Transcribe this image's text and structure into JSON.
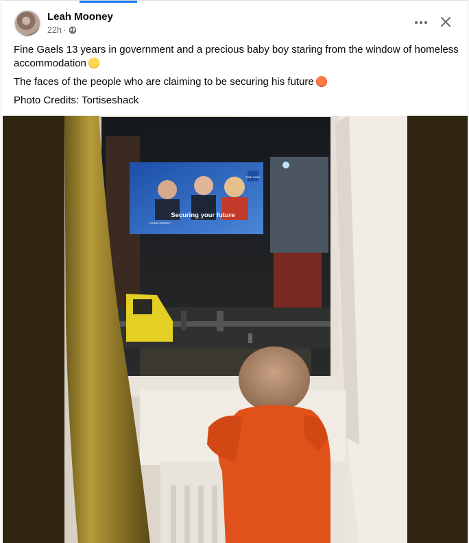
{
  "post": {
    "author": "Leah Mooney",
    "time": "22h",
    "separator": "·",
    "paragraphs": [
      "Fine Gaels 13 years in government and a precious baby boy staring from the window of homeless accommodation",
      "The faces of the people who are claiming to be securing his future",
      "Photo Credits: Tortiseshack"
    ],
    "emojis": [
      "crying-face",
      "angry-face"
    ]
  },
  "photo": {
    "billboard_slogan": "Securing your future",
    "billboard_logo": "FINE GAEL",
    "billboard_small": "A NEW ENERGY"
  },
  "icons": {
    "more": "more-icon",
    "close": "close-icon",
    "privacy": "globe-icon"
  },
  "colors": {
    "accent": "#1877f2",
    "meta_text": "#65676b",
    "onesie": "#e0521a"
  }
}
